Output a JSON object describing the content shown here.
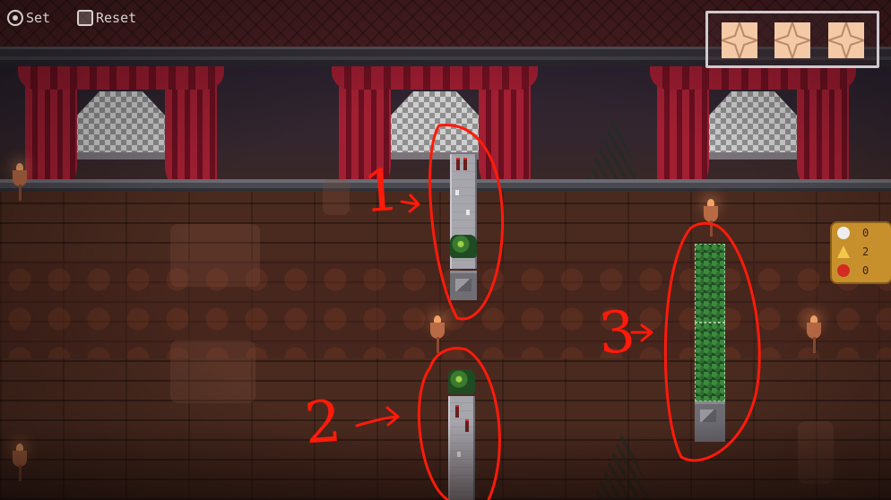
{
  "hud": {
    "set_label": "Set",
    "reset_label": "Reset",
    "stars_icon": "star-icon",
    "counters": [
      {
        "kind": "info",
        "icon": "info-icon",
        "value": "0"
      },
      {
        "kind": "warning",
        "icon": "warning-icon",
        "value": "2"
      },
      {
        "kind": "error",
        "icon": "error-icon",
        "value": "0"
      }
    ]
  },
  "annotations": {
    "labels": [
      "1",
      "2",
      "3"
    ],
    "color": "#ff1a0a"
  },
  "colors": {
    "star": "#f3c9a6",
    "counter_panel": "#c8902c",
    "curtain": "#a21f33"
  }
}
